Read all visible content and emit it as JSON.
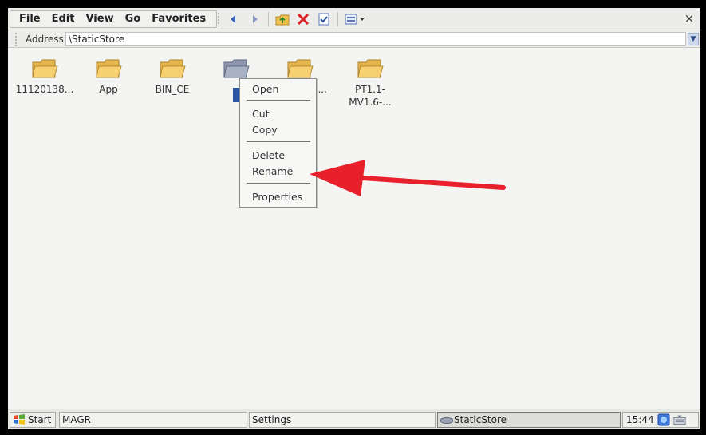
{
  "menubar": {
    "menus": [
      "File",
      "Edit",
      "View",
      "Go",
      "Favorites"
    ],
    "toolbar_icons": [
      "back-arrow-icon",
      "forward-arrow-icon",
      "up-folder-icon",
      "delete-x-icon",
      "properties-icon",
      "views-menu-icon"
    ],
    "close_label": "×"
  },
  "address": {
    "label": "Address",
    "value": "\\StaticStore"
  },
  "files": [
    {
      "name": "11120138...",
      "selected": false
    },
    {
      "name": "App",
      "selected": false
    },
    {
      "name": "BIN_CE",
      "selected": false
    },
    {
      "name": "",
      "selected": true
    },
    {
      "name": "...on...",
      "selected": false
    },
    {
      "name": "PT1.1-\nMV1.6-...",
      "selected": false
    }
  ],
  "context_menu": {
    "items": [
      "Open",
      "Cut",
      "Copy",
      "Delete",
      "Rename",
      "Properties"
    ]
  },
  "taskbar": {
    "start_label": "Start",
    "tasks": [
      "MAGR",
      "Settings",
      "StaticStore"
    ],
    "active_task": "StaticStore",
    "clock": "15:44"
  },
  "colors": {
    "arrow": "#e8202c",
    "folder": "#f5c75a",
    "selection": "#2b53a6"
  }
}
